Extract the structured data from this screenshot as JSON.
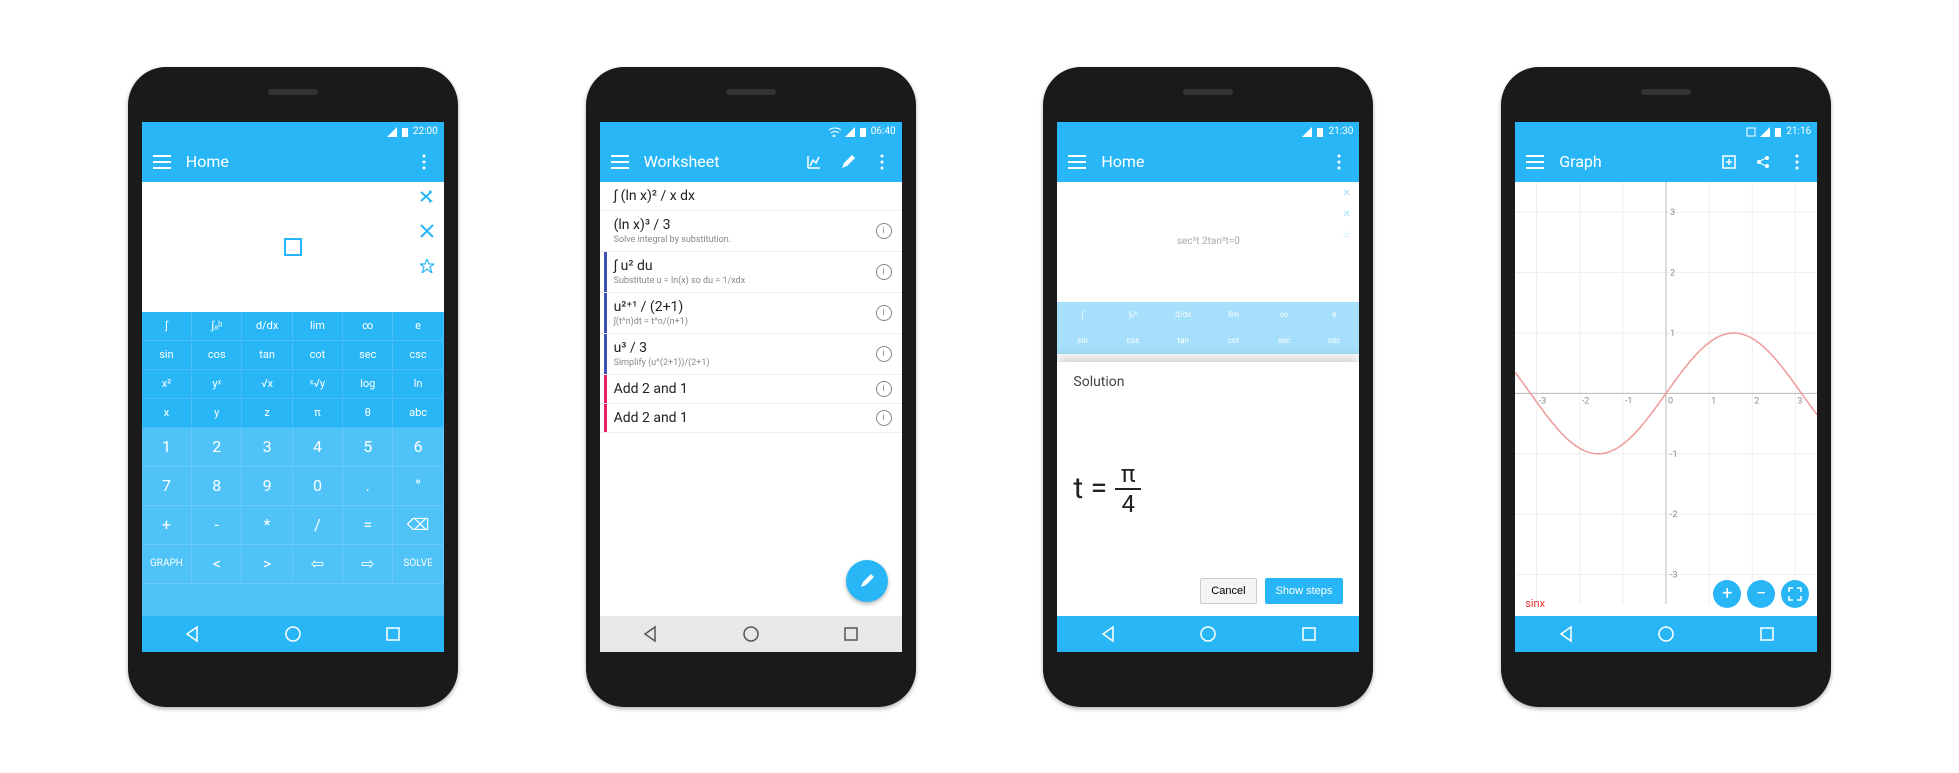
{
  "phones": [
    {
      "status_time": "22:00",
      "title": "Home",
      "side_icons": [
        "shuffle",
        "close",
        "star"
      ],
      "func_rows": [
        [
          "∫",
          "∫ₐᵇ",
          "d/dx",
          "lim",
          "∞",
          "e"
        ],
        [
          "sin",
          "cos",
          "tan",
          "cot",
          "sec",
          "csc"
        ],
        [
          "x²",
          "yˣ",
          "√x",
          "ˣ√y",
          "log",
          "ln"
        ],
        [
          "x",
          "y",
          "z",
          "π",
          "θ",
          "abc"
        ]
      ],
      "main_rows": [
        [
          "1",
          "2",
          "3",
          "4",
          "5",
          "6"
        ],
        [
          "7",
          "8",
          "9",
          "0",
          ".",
          "°"
        ],
        [
          "+",
          "-",
          "*",
          "/",
          "=",
          "⌫"
        ],
        [
          "GRAPH",
          "<",
          ">",
          "⇦",
          "⇨",
          "SOLVE"
        ]
      ]
    },
    {
      "status_time": "06:40",
      "title": "Worksheet",
      "items": [
        {
          "math": "∫ (ln x)² / x  dx",
          "note": "",
          "bar": ""
        },
        {
          "math": "(ln x)³ / 3",
          "note": "Solve integral by substitution.",
          "bar": ""
        },
        {
          "math": "∫ u² du",
          "note": "Substitute u = ln(x) so du = 1/xdx",
          "bar": "#3f51b5"
        },
        {
          "math": "u²⁺¹ / (2+1)",
          "note": "∫(t^n)dt = t^n/(n+1)",
          "bar": "#3f51b5"
        },
        {
          "math": "u³ / 3",
          "note": "Simplify (u^(2+1))/(2+1)",
          "bar": "#3f51b5"
        },
        {
          "math": "Add 2 and 1",
          "note": "",
          "bar": "#e91e63"
        },
        {
          "math": "Add 2 and 1",
          "note": "",
          "bar": "#e91e63"
        }
      ]
    },
    {
      "status_time": "21:30",
      "title": "Home",
      "faded_expr": "sec²t 2tan²t=0",
      "dialog_title": "Solution",
      "solution_lhs": "t =",
      "solution_num": "π",
      "solution_den": "4",
      "btn_cancel": "Cancel",
      "btn_steps": "Show steps"
    },
    {
      "status_time": "21:16",
      "title": "Graph",
      "function_label": "sinx",
      "x_ticks": [
        -3,
        -2,
        -1,
        0,
        1,
        2,
        3
      ],
      "y_ticks": [
        -3,
        -2,
        -1,
        1,
        2,
        3
      ],
      "fab_icons": [
        "plus",
        "minus",
        "fullscreen"
      ]
    }
  ],
  "chart_data": {
    "type": "line",
    "title": "",
    "xlabel": "",
    "ylabel": "",
    "xlim": [
      -3.5,
      3.5
    ],
    "ylim": [
      -3.5,
      3.5
    ],
    "series": [
      {
        "name": "sinx",
        "color": "#ef9a9a",
        "x": [
          -3.14,
          -2.5,
          -2,
          -1.57,
          -1,
          -0.5,
          0,
          0.5,
          1,
          1.57,
          2,
          2.5,
          3.14
        ],
        "y": [
          0,
          -0.6,
          -0.91,
          -1,
          -0.84,
          -0.48,
          0,
          0.48,
          0.84,
          1,
          0.91,
          0.6,
          0
        ]
      }
    ]
  }
}
